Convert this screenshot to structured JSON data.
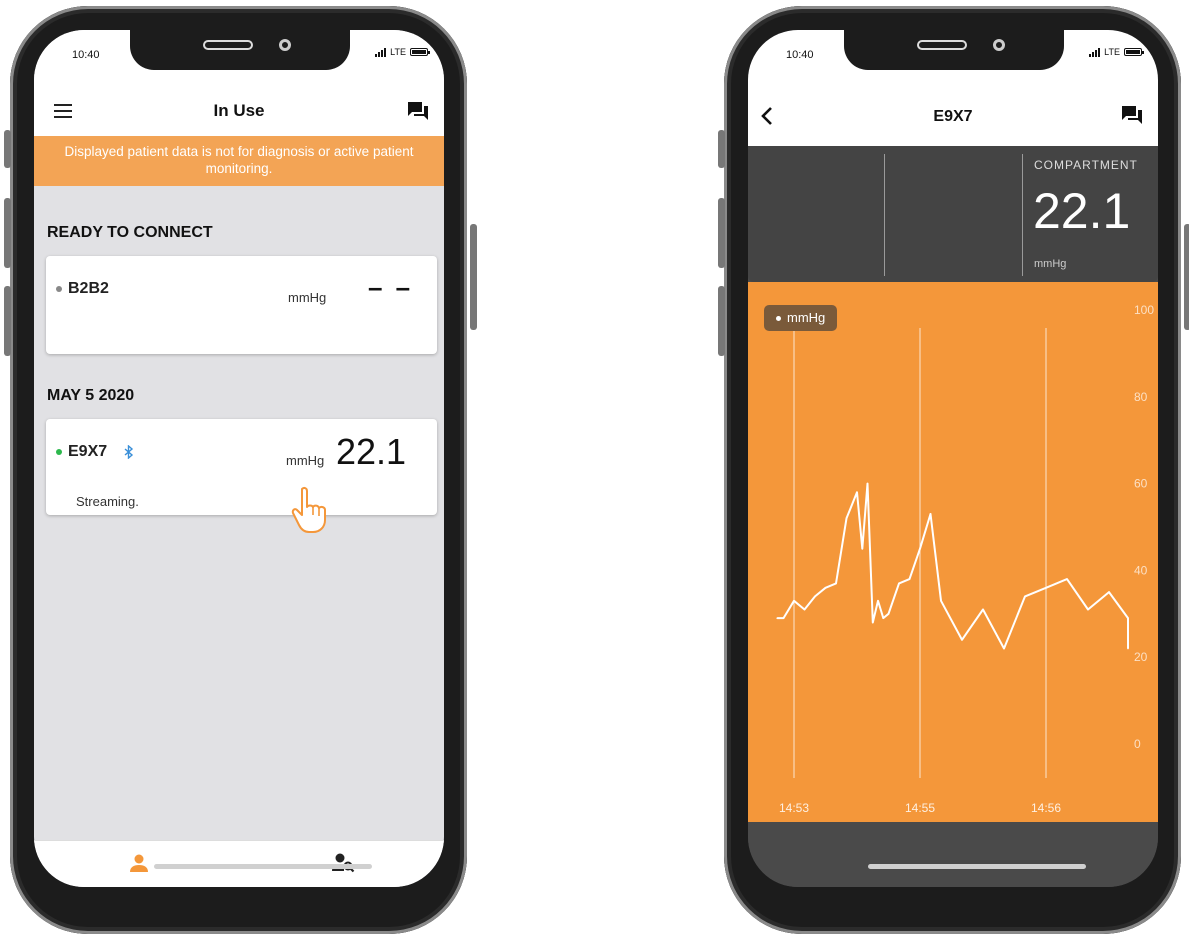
{
  "status_bar": {
    "time": "10:40",
    "network": "LTE"
  },
  "left_phone": {
    "title": "In Use",
    "banner": "Displayed patient data is not for diagnosis or active patient monitoring.",
    "section_ready": "READY TO CONNECT",
    "ready_device": {
      "name": "B2B2",
      "unit": "mmHg",
      "value": "– –",
      "status_color": "#888888"
    },
    "section_date": "MAY 5 2020",
    "active_device": {
      "name": "E9X7",
      "unit": "mmHg",
      "value": "22.1",
      "status": "Streaming.",
      "status_color": "#2db84d"
    },
    "nav": [
      {
        "icon": "person-icon",
        "active": true
      },
      {
        "icon": "person-search-icon",
        "active": false
      }
    ]
  },
  "right_phone": {
    "title": "E9X7",
    "metric_label": "COMPARTMENT",
    "metric_value": "22.1",
    "metric_unit": "mmHg",
    "legend": "mmHg"
  },
  "colors": {
    "accent": "#f4973a",
    "banner": "#f3a455",
    "dark_panel": "#444444"
  },
  "chart_data": {
    "type": "line",
    "series": [
      {
        "name": "mmHg",
        "x": [
          "14:52:44",
          "14:52:50",
          "14:53:00",
          "14:53:10",
          "14:53:20",
          "14:53:30",
          "14:53:40",
          "14:53:50",
          "14:54:00",
          "14:54:05",
          "14:54:10",
          "14:54:15",
          "14:54:20",
          "14:54:25",
          "14:54:30",
          "14:54:40",
          "14:54:50",
          "14:55:00",
          "14:55:05",
          "14:55:10",
          "14:55:20",
          "14:55:30",
          "14:55:40",
          "14:55:50",
          "14:56:00",
          "14:56:10",
          "14:56:20",
          "14:56:30",
          "14:56:40",
          "14:56:50"
        ],
        "values": [
          29,
          29,
          33,
          31,
          34,
          36,
          37,
          52,
          58,
          45,
          60,
          28,
          33,
          29,
          30,
          37,
          38,
          45,
          53,
          33,
          24,
          31,
          22,
          34,
          36,
          38,
          31,
          35,
          29,
          22
        ]
      }
    ],
    "x_ticks": [
      "14:53",
      "14:55",
      "14:56"
    ],
    "y_ticks": [
      0,
      20,
      40,
      60,
      80,
      100
    ],
    "ylim": [
      0,
      100
    ],
    "grid": "vertical",
    "legend": "top-left"
  }
}
